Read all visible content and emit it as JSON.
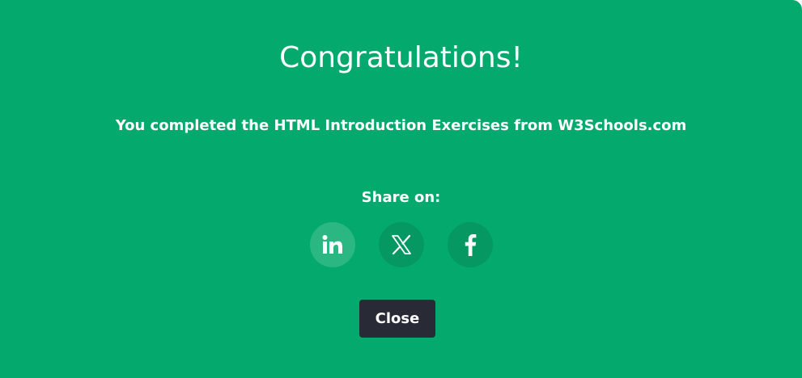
{
  "modal": {
    "title": "Congratulations!",
    "message": "You completed the HTML Introduction Exercises from W3Schools.com",
    "share_label": "Share on:",
    "share_buttons": [
      {
        "icon": "linkedin-icon",
        "network": "LinkedIn"
      },
      {
        "icon": "x-icon",
        "network": "X"
      },
      {
        "icon": "facebook-icon",
        "network": "Facebook"
      }
    ],
    "close_label": "Close"
  },
  "colors": {
    "background": "#04aa6d",
    "share_button": "#059862",
    "share_button_highlight": "#2ab781",
    "close_button": "#282a35",
    "text": "#ffffff"
  }
}
